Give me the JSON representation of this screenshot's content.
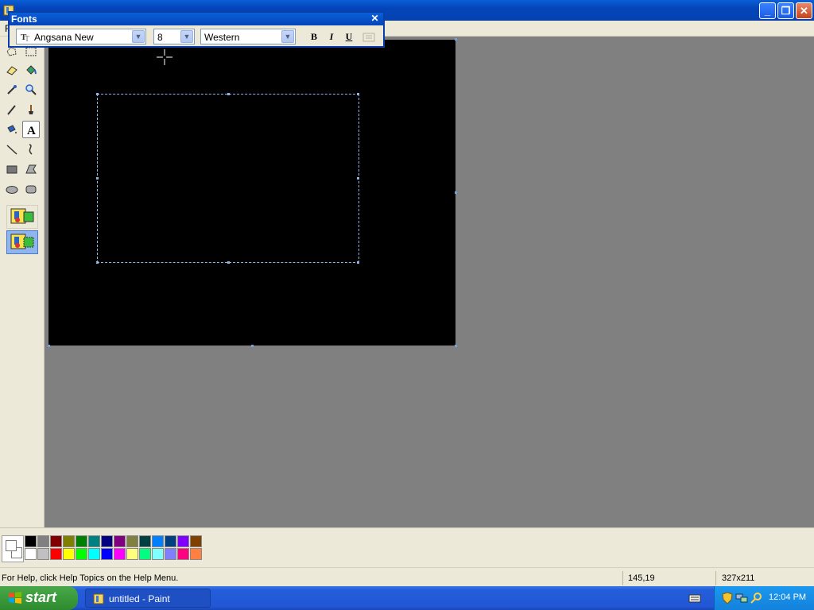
{
  "window": {
    "title": "untitled - Paint"
  },
  "menubar": {
    "first_letter": "F"
  },
  "fonts_toolbar": {
    "title": "Fonts",
    "font_name": "Angsana New",
    "font_size": "8",
    "script": "Western",
    "bold_label": "B",
    "italic_label": "I",
    "underline_label": "U"
  },
  "tools": [
    "free-form-select-icon",
    "select-icon",
    "eraser-icon",
    "fill-icon",
    "pick-color-icon",
    "magnifier-icon",
    "pencil-icon",
    "brush-icon",
    "airbrush-icon",
    "text-icon",
    "line-icon",
    "curve-icon",
    "rectangle-icon",
    "polygon-icon",
    "ellipse-icon",
    "rounded-rectangle-icon"
  ],
  "selected_tool": "text-icon",
  "palette": {
    "top_row": [
      "#000000",
      "#808080",
      "#800000",
      "#808000",
      "#008000",
      "#008080",
      "#000080",
      "#800080",
      "#808040",
      "#004040",
      "#0080ff",
      "#004080",
      "#8000ff",
      "#804000"
    ],
    "bottom_row": [
      "#ffffff",
      "#c0c0c0",
      "#ff0000",
      "#ffff00",
      "#00ff00",
      "#00ffff",
      "#0000ff",
      "#ff00ff",
      "#ffff80",
      "#00ff80",
      "#80ffff",
      "#8080ff",
      "#ff0080",
      "#ff8040"
    ],
    "foreground": "#ffffff",
    "background": "#ffffff"
  },
  "canvas": {
    "background": "#000000"
  },
  "status": {
    "help_text": "For Help, click Help Topics on the Help Menu.",
    "coords": "145,19",
    "size": "327x211"
  },
  "taskbar": {
    "start_label": "start",
    "task_label": "untitled - Paint",
    "clock": "12:04 PM"
  }
}
